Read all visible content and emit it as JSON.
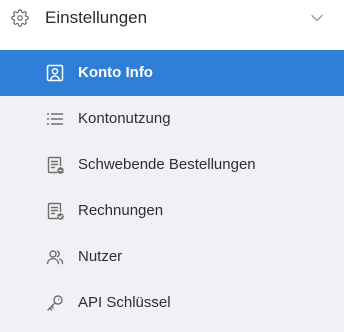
{
  "menu": {
    "title": "Einstellungen",
    "header_icon": "gear-icon",
    "toggle_icon": "chevron-down-icon"
  },
  "items": [
    {
      "label": "Konto Info",
      "icon": "account-card-icon",
      "active": true
    },
    {
      "label": "Kontonutzung",
      "icon": "list-icon",
      "active": false
    },
    {
      "label": "Schwebende Bestellungen",
      "icon": "pending-document-icon",
      "active": false
    },
    {
      "label": "Rechnungen",
      "icon": "invoice-document-icon",
      "active": false
    },
    {
      "label": "Nutzer",
      "icon": "users-icon",
      "active": false
    },
    {
      "label": "API Schlüssel",
      "icon": "key-icon",
      "active": false
    }
  ],
  "colors": {
    "accent": "#2f7fd9",
    "submenu_background": "#f0f1f4"
  }
}
